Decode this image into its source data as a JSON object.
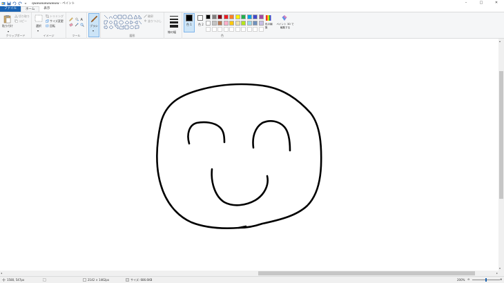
{
  "title_bar": {
    "title": "qwwwwwwwwww - ペイント",
    "controls": [
      "–",
      "□",
      "✕"
    ]
  },
  "tabs": [
    {
      "label": "ファイル"
    },
    {
      "label": "ホーム"
    },
    {
      "label": "表示"
    }
  ],
  "ribbon": {
    "clipboard": {
      "paste": "貼り付け",
      "cut": "切り取り",
      "copy": "コピー",
      "label": "クリップボード"
    },
    "image": {
      "select": "選択",
      "crop": "トリミング",
      "resize": "サイズ変更",
      "rotate": "回転",
      "label": "イメージ"
    },
    "tools": {
      "label": "ツール"
    },
    "brushes": {
      "label": "ブラシ"
    },
    "shapes": {
      "outline": "輪郭",
      "fill": "塗りつぶし",
      "label": "図形"
    },
    "size": {
      "label": "線の幅"
    },
    "colors": {
      "color1": "色 1",
      "color2": "色 2",
      "edit": "色の編集",
      "paint3d": "ペイント 3D で編集する",
      "label": "色",
      "palette_row1": [
        "#000000",
        "#7f7f7f",
        "#880015",
        "#ed1c24",
        "#ff7f27",
        "#fff200",
        "#22b14c",
        "#00a2e8",
        "#3f48cc",
        "#a349a4"
      ],
      "palette_row2": [
        "#ffffff",
        "#c3c3c3",
        "#b97a57",
        "#ffaec9",
        "#ffc90e",
        "#efe4b0",
        "#b5e61d",
        "#99d9ea",
        "#7092be",
        "#c8bfe7"
      ],
      "color1_value": "#000000",
      "color2_value": "#ffffff"
    }
  },
  "status_bar": {
    "cursor": "1580, 547px",
    "canvas_size": "2142 × 1462px",
    "file_size": "サイズ: 686.6KB",
    "zoom": "200%"
  }
}
